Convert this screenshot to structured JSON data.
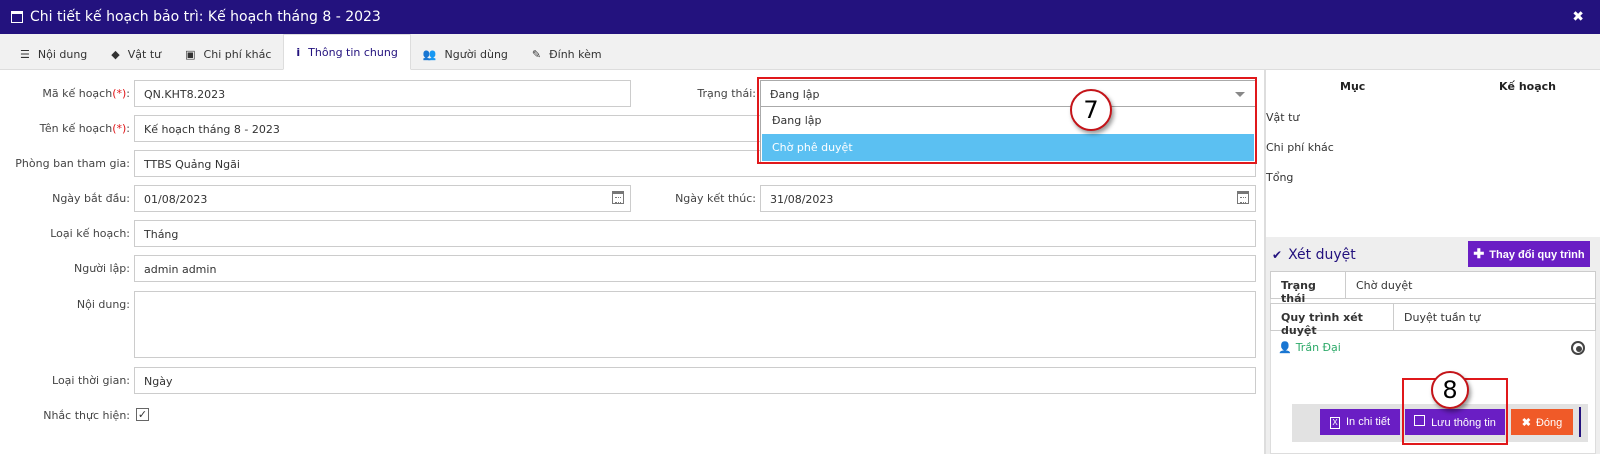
{
  "title": "Chi tiết kế hoạch bảo trì: Kế hoạch tháng 8 - 2023",
  "tabs": [
    {
      "label": "Nội dung",
      "icon": "list-icon"
    },
    {
      "label": "Vật tư",
      "icon": "tag-icon"
    },
    {
      "label": "Chi phí khác",
      "icon": "money-icon"
    },
    {
      "label": "Thông tin chung",
      "icon": "info-icon",
      "active": true
    },
    {
      "label": "Người dùng",
      "icon": "users-icon"
    },
    {
      "label": "Đính kèm",
      "icon": "paperclip-icon"
    }
  ],
  "form": {
    "ma_label": "Mã kế hoạch",
    "ma_value": "QN.KHT8.2023",
    "ten_label": "Tên kế hoạch",
    "ten_value": "Kế hoạch tháng 8 - 2023",
    "required_mark": "(*)",
    "colon": ":",
    "phongban_label": "Phòng ban tham gia:",
    "phongban_value": "TTBS Quảng Ngãi",
    "ngaybatdau_label": "Ngày bắt đầu:",
    "ngaybatdau_value": "01/08/2023",
    "ngayketthuc_label": "Ngày kết thúc:",
    "ngayketthuc_value": "31/08/2023",
    "loaikh_label": "Loại kế hoạch:",
    "loaikh_value": "Tháng",
    "nguoilap_label": "Người lập:",
    "nguoilap_value": "admin admin",
    "noidung_label": "Nội dung:",
    "noidung_value": "",
    "loaitg_label": "Loại thời gian:",
    "loaitg_value": "Ngày",
    "nhac_label": "Nhắc thực hiện:",
    "nhac_checked": true,
    "trangthai_label": "Trạng thái:",
    "trangthai_value": "Đang lập",
    "trangthai_options": [
      "Đang lập",
      "Chờ phê duyệt"
    ],
    "trangthai_highlighted": "Chờ phê duyệt"
  },
  "summary": {
    "col_muc": "Mục",
    "col_kehoach": "Kế hoạch",
    "rows": [
      "Vật tư",
      "Chi phí khác",
      "Tổng"
    ]
  },
  "review": {
    "title": "Xét duyệt",
    "change_btn": "Thay đổi quy trình",
    "status_tab": "Trạng thái",
    "status_value": "Chờ duyệt",
    "process_tab": "Quy trình xét duyệt",
    "process_value": "Duyệt tuần tự",
    "user": "Trần Đại"
  },
  "actions": {
    "print": "In chi tiết",
    "save": "Lưu thông tin",
    "close": "Đóng"
  },
  "annotations": {
    "step7": "7",
    "step8": "8"
  },
  "colors": {
    "header": "#23127e",
    "purple": "#6a1ec4",
    "orange": "#f05a28",
    "highlight": "#5bc0f2",
    "callout": "#e0181b",
    "green": "#2eaa6a"
  }
}
